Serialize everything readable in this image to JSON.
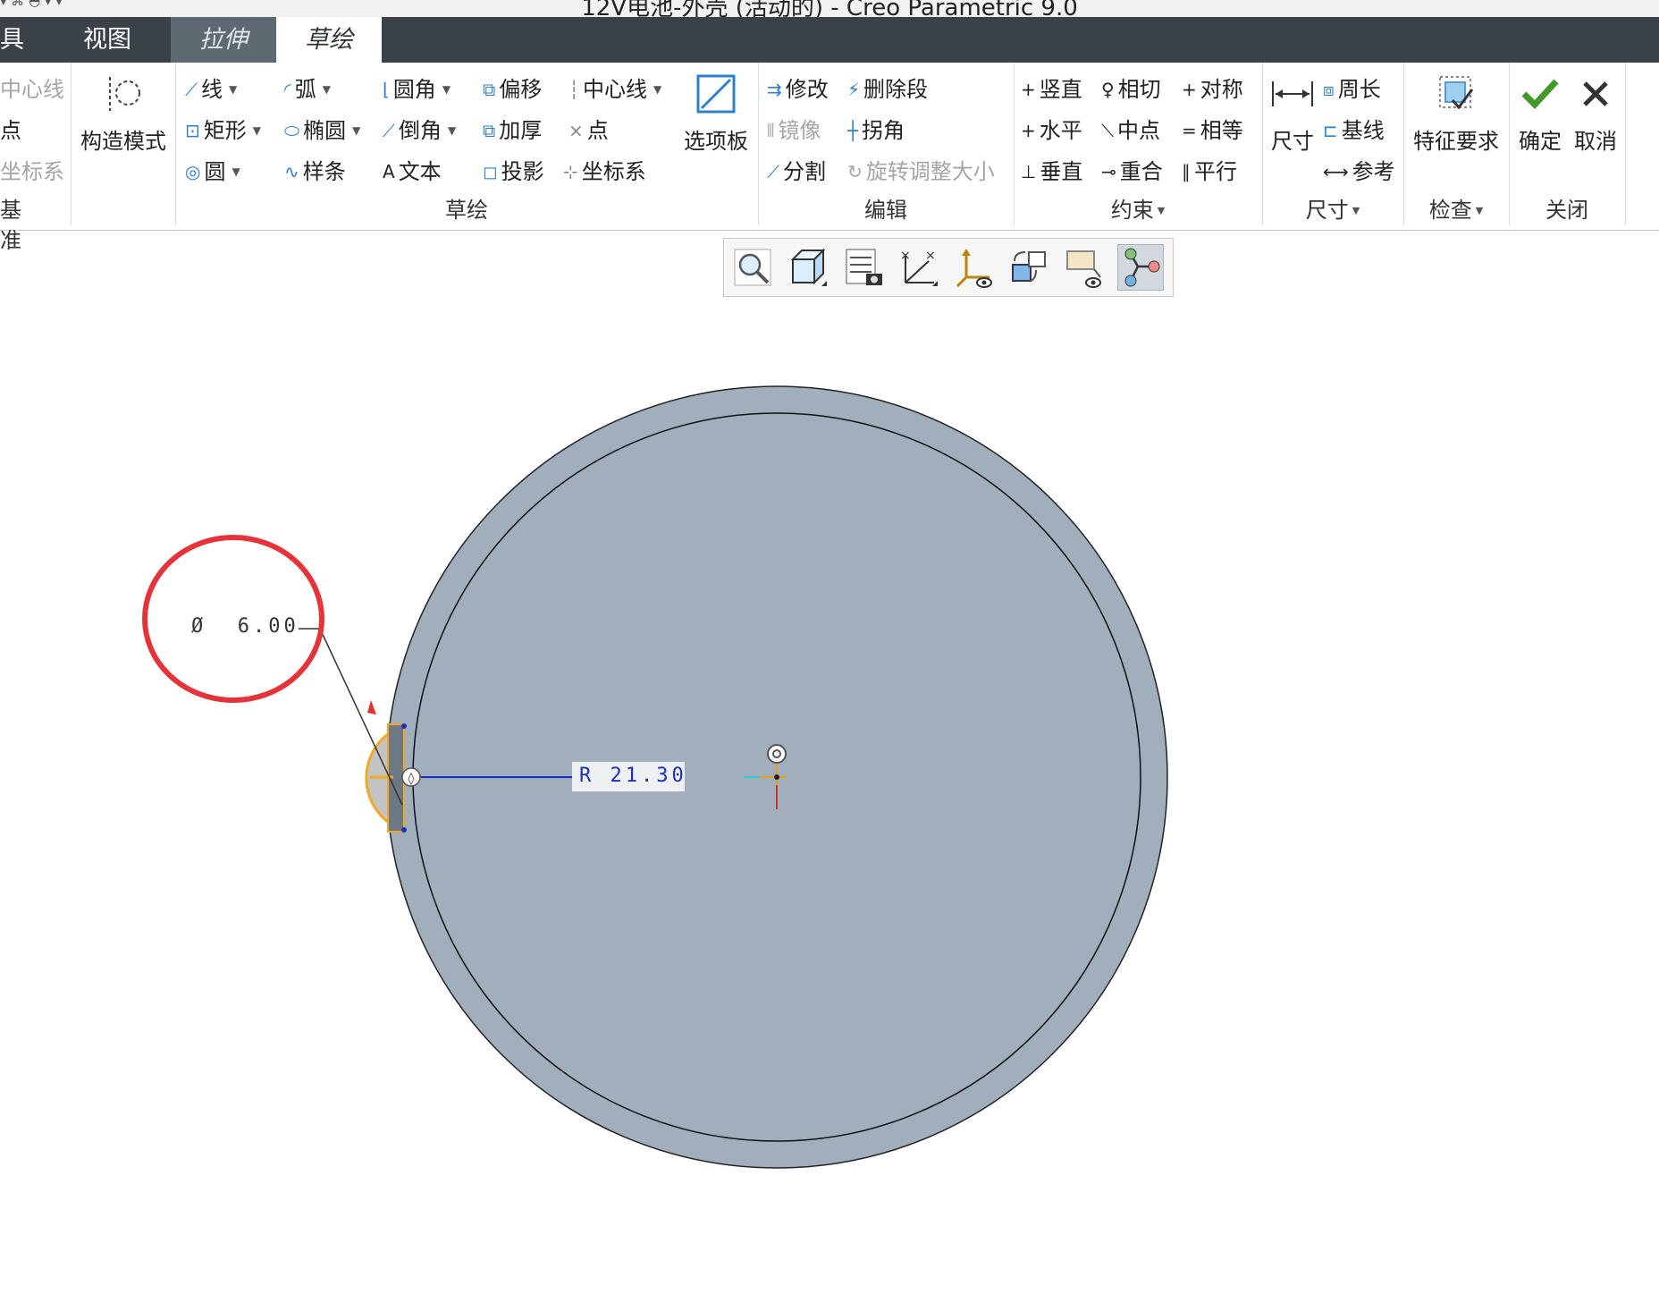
{
  "window": {
    "title": "12V电池-外壳 (活动的) - Creo Parametric 9.0",
    "quick_access": "▾ ⌘ ◓ ▾  ▾"
  },
  "tabs": [
    {
      "label": "具"
    },
    {
      "label": "视图"
    },
    {
      "label": "拉伸"
    },
    {
      "label": "草绘"
    }
  ],
  "ribbon": {
    "datum": {
      "centerline": "中心线",
      "point": "点",
      "csys": "坐标系",
      "group": "基准"
    },
    "construction_mode": "构造模式",
    "sketch": {
      "line": "线",
      "arc": "弧",
      "fillet": "圆角",
      "offset": "偏移",
      "centerline": "中心线",
      "rectangle": "矩形",
      "ellipse": "椭圆",
      "chamfer": "倒角",
      "thicken": "加厚",
      "point": "点",
      "circle": "圆",
      "spline": "样条",
      "text": "文本",
      "project": "投影",
      "csys": "坐标系",
      "palette": "选项板",
      "group": "草绘"
    },
    "edit": {
      "modify": "修改",
      "delete_segment": "删除段",
      "mirror": "镜像",
      "corner": "拐角",
      "divide": "分割",
      "rotate_resize": "旋转调整大小",
      "group": "编辑"
    },
    "constrain": {
      "vertical": "竖直",
      "tangent": "相切",
      "symmetric": "对称",
      "horizontal": "水平",
      "midpoint": "中点",
      "equal": "相等",
      "perpendicular": "垂直",
      "coincident": "重合",
      "parallel": "平行",
      "group": "约束"
    },
    "dimension": {
      "dimension": "尺寸",
      "perimeter": "周长",
      "baseline": "基线",
      "reference": "参考",
      "group": "尺寸"
    },
    "inspect": {
      "feature_requirements": "特征要求",
      "group": "检查"
    },
    "close": {
      "ok": "确定",
      "cancel": "取消",
      "group": "关闭"
    }
  },
  "view_toolbar": [
    "refit-icon",
    "view-orientation-icon",
    "section-display-icon",
    "sketch-display-icon",
    "datum-display-icon",
    "view-manager-icon",
    "annotation-display-icon",
    "sketch-references-icon"
  ],
  "sketch": {
    "diameter_dim": "Ø  6.00",
    "radius_dim": "R 21.30"
  },
  "colors": {
    "tab_bar": "#3b4247",
    "disk_fill": "#a1aebc",
    "highlight": "#f5a623",
    "annotation_circle": "#e6333a",
    "dimension_line": "#1a2fbf"
  }
}
